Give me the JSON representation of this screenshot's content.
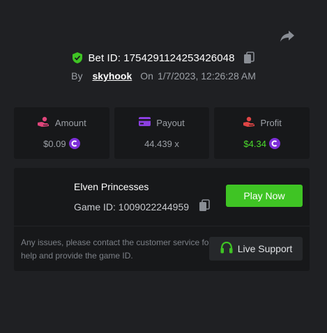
{
  "header": {
    "bet_id_label": "Bet ID: 1754291124253426048",
    "by_label": "By",
    "username": "skyhook",
    "on_label": "On",
    "timestamp": "1/7/2023, 12:26:28 AM"
  },
  "stats": {
    "amount": {
      "label": "Amount",
      "value": "$0.09",
      "icon": "hand-coins-icon"
    },
    "payout": {
      "label": "Payout",
      "value": "44.439 x",
      "icon": "card-icon"
    },
    "profit": {
      "label": "Profit",
      "value": "$4.34",
      "icon": "hand-profit-icon"
    }
  },
  "game": {
    "name": "Elven Princesses",
    "game_id_label": "Game ID: 1009022244959",
    "play_label": "Play Now",
    "issues_text": "Any issues, please contact the customer service for help and provide the game ID.",
    "support_label": "Live Support"
  },
  "colors": {
    "background": "#1f2023",
    "panel": "#17181a",
    "accent_green": "#3fc424",
    "profit_green": "#4cdc2c",
    "coin_purple": "#7d2fd8",
    "amount_pink": "#e0457b",
    "payout_purple": "#8b3fe0",
    "profit_red": "#e04545"
  }
}
